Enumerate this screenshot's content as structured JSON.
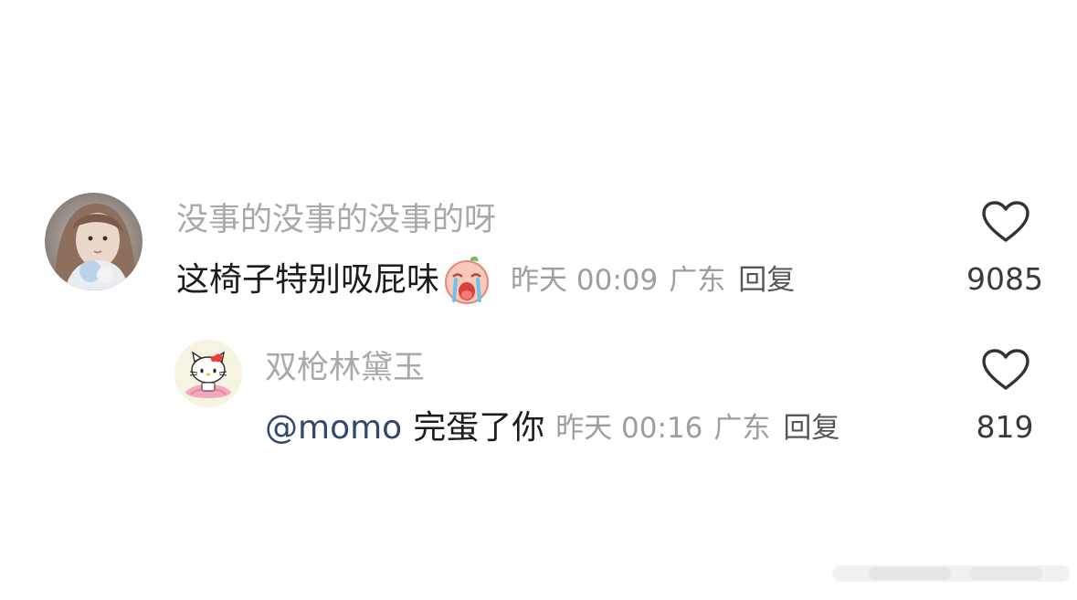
{
  "comment": {
    "username": "没事的没事的没事的呀",
    "text": "这椅子特别吸屁味",
    "emoji": "crying-face-emoji",
    "time": "昨天 00:09",
    "location": "广东",
    "reply_label": "回复",
    "like_count": "9085",
    "avatar": "girl-photo-avatar"
  },
  "reply": {
    "username": "双枪林黛玉",
    "mention": "@momo",
    "text": "完蛋了你",
    "time": "昨天 00:16",
    "location": "广东",
    "reply_label": "回复",
    "like_count": "819",
    "avatar": "hello-kitty-avatar"
  },
  "icons": {
    "like": "heart-outline-icon"
  },
  "colors": {
    "username": "#a9a9a9",
    "comment_text": "#1c1c1c",
    "mention": "#33496b",
    "meta": "#9e9e9e",
    "reply_link": "#575757",
    "like_count": "#3a3a3a",
    "heart_stroke": "#333333"
  }
}
